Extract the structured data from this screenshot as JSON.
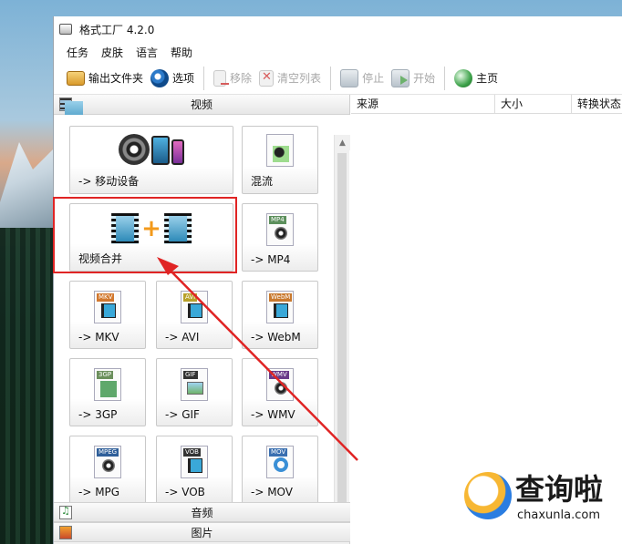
{
  "window": {
    "title": "格式工厂 4.2.0"
  },
  "menu": [
    "任务",
    "皮肤",
    "语言",
    "帮助"
  ],
  "toolbar": {
    "output_folder": "输出文件夹",
    "options": "选项",
    "remove": "移除",
    "clear_list": "清空列表",
    "stop": "停止",
    "start": "开始",
    "home": "主页"
  },
  "categories": {
    "video": "视频",
    "audio": "音频",
    "image": "图片"
  },
  "tiles": [
    {
      "label": "-> 移动设备",
      "icon": "mobile-devices-icon"
    },
    {
      "label": "混流",
      "icon": "mux-icon"
    },
    {
      "label": "视频合并",
      "icon": "video-merge-icon"
    },
    {
      "label": "-> MP4",
      "icon": "mp4-file-icon",
      "tag": "MP4"
    },
    {
      "label": "-> MKV",
      "icon": "mkv-file-icon",
      "tag": "MKV"
    },
    {
      "label": "-> AVI",
      "icon": "avi-file-icon",
      "tag": "AVI"
    },
    {
      "label": "-> WebM",
      "icon": "webm-file-icon",
      "tag": "WebM"
    },
    {
      "label": "-> 3GP",
      "icon": "3gp-file-icon",
      "tag": "3GP"
    },
    {
      "label": "-> GIF",
      "icon": "gif-file-icon",
      "tag": "GIF"
    },
    {
      "label": "-> WMV",
      "icon": "wmv-file-icon",
      "tag": "WMV"
    },
    {
      "label": "-> MPG",
      "icon": "mpg-file-icon",
      "tag": "MPEG"
    },
    {
      "label": "-> VOB",
      "icon": "vob-file-icon",
      "tag": "VOB"
    },
    {
      "label": "-> MOV",
      "icon": "mov-file-icon",
      "tag": "MOV"
    }
  ],
  "list_columns": [
    "来源",
    "大小",
    "转换状态"
  ],
  "watermark": {
    "name": "查询啦",
    "url": "chaxunla.com"
  },
  "colors": {
    "highlight": "#e02424",
    "arrow": "#e02424",
    "merge_plus": "#f39a1b"
  }
}
